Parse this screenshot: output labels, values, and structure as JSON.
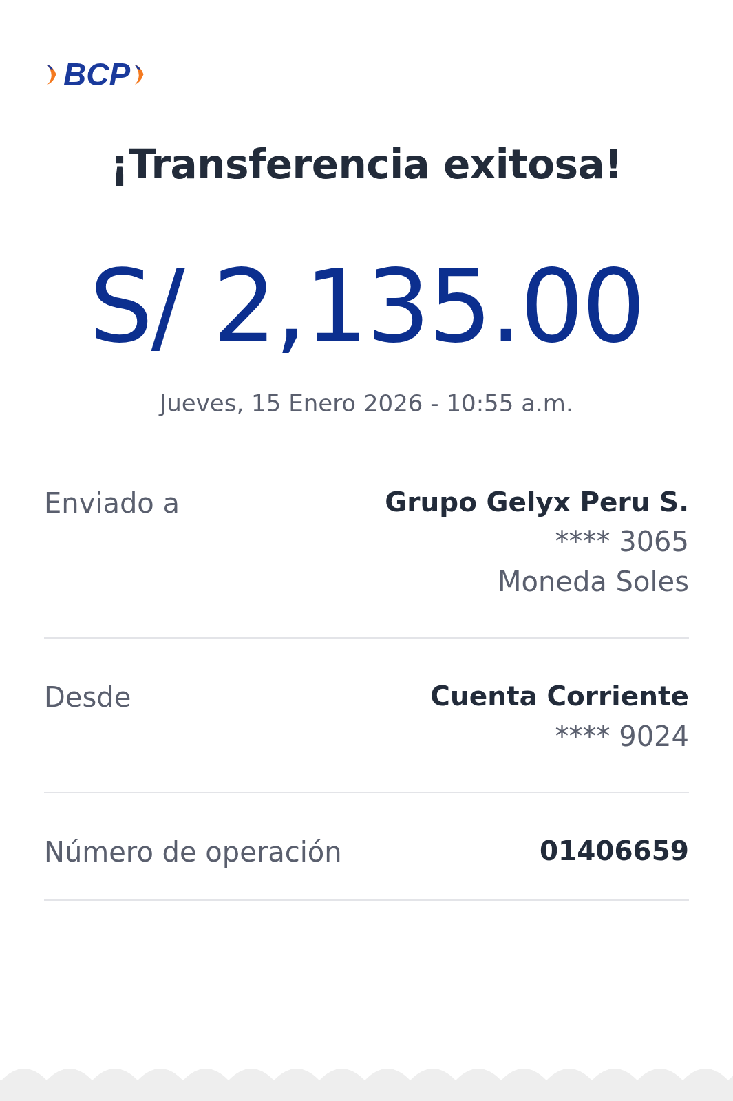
{
  "logo": {
    "text": "BCP"
  },
  "title": "¡Transferencia exitosa!",
  "amount": "S/ 2,135.00",
  "datetime": "Jueves, 15 Enero 2026 - 10:55 a.m.",
  "details": [
    {
      "label": "Enviado a",
      "values": [
        {
          "text": "Grupo Gelyx Peru S.",
          "kind": "primary"
        },
        {
          "text": "**** 3065",
          "kind": "secondary"
        },
        {
          "text": "Moneda Soles",
          "kind": "secondary"
        }
      ]
    },
    {
      "label": "Desde",
      "values": [
        {
          "text": "Cuenta Corriente",
          "kind": "primary"
        },
        {
          "text": "**** 9024",
          "kind": "secondary"
        }
      ]
    },
    {
      "label": "Número de operación",
      "values": [
        {
          "text": "01406659",
          "kind": "primary"
        }
      ]
    }
  ]
}
